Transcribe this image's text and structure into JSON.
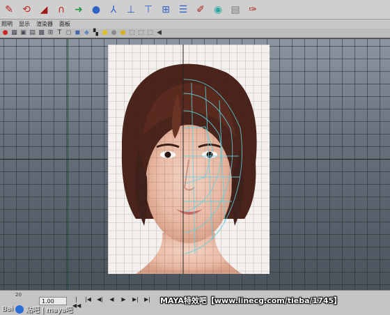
{
  "shelf": {
    "icons": [
      {
        "name": "curve-tool-icon",
        "glyph": "✎",
        "color": "#b8211b"
      },
      {
        "name": "lasso-icon",
        "glyph": "⟲",
        "color": "#c0261d"
      },
      {
        "name": "bevel-icon",
        "glyph": "◢",
        "color": "#9e1a16"
      },
      {
        "name": "magnet-icon",
        "glyph": "∩",
        "color": "#c72420"
      },
      {
        "name": "arrow-right-icon",
        "glyph": "➜",
        "color": "#24983a"
      },
      {
        "name": "sphere-icon",
        "glyph": "●",
        "color": "#2f63c8"
      },
      {
        "name": "joint-icon",
        "glyph": "⅄",
        "color": "#2f63c8"
      },
      {
        "name": "skeleton-icon",
        "glyph": "⊥",
        "color": "#2f63c8"
      },
      {
        "name": "hierarchy-icon",
        "glyph": "⊤",
        "color": "#2f63c8"
      },
      {
        "name": "blend-icon",
        "glyph": "⊞",
        "color": "#2f63c8"
      },
      {
        "name": "list-icon",
        "glyph": "☰",
        "color": "#2f63c8"
      },
      {
        "name": "paint-icon",
        "glyph": "✐",
        "color": "#b0221c"
      },
      {
        "name": "render-icon",
        "glyph": "◉",
        "color": "#2aa7a0"
      },
      {
        "name": "layer-icon",
        "glyph": "▤",
        "color": "#777777"
      },
      {
        "name": "brush-icon",
        "glyph": "✑",
        "color": "#b22b22"
      }
    ]
  },
  "menubar": {
    "items": [
      "照明",
      "显示",
      "渲染器",
      "面板"
    ]
  },
  "viewtools": {
    "icons": [
      {
        "name": "camera-icon",
        "glyph": "●",
        "color": "#c22"
      },
      {
        "name": "wireframe-icon",
        "glyph": "▦",
        "color": "#445"
      },
      {
        "name": "shaded-icon",
        "glyph": "▣",
        "color": "#445"
      },
      {
        "name": "textured-icon",
        "glyph": "▤",
        "color": "#445"
      },
      {
        "name": "lights-icon",
        "glyph": "▩",
        "color": "#445"
      },
      {
        "name": "grid-toggle-icon",
        "glyph": "⊞",
        "color": "#445"
      },
      {
        "name": "text-icon",
        "glyph": "T",
        "color": "#222"
      },
      {
        "name": "cube-wire-icon",
        "glyph": "◻",
        "color": "#555"
      },
      {
        "name": "cube-shaded-icon",
        "glyph": "◼",
        "color": "#4466aa"
      },
      {
        "name": "cube-smooth-icon",
        "glyph": "◆",
        "color": "#6688bb"
      },
      {
        "name": "checker-icon",
        "glyph": "▚",
        "color": "#222"
      },
      {
        "name": "light-icon",
        "glyph": "●",
        "color": "#e0c020"
      },
      {
        "name": "shadow-icon",
        "glyph": "●",
        "color": "#888"
      },
      {
        "name": "ao-icon",
        "glyph": "●",
        "color": "#d8b020"
      },
      {
        "name": "select-icon",
        "glyph": "⬚",
        "color": "#555"
      },
      {
        "name": "isolate-icon",
        "glyph": "⬚",
        "color": "#555"
      },
      {
        "name": "xray-icon",
        "glyph": "⬚",
        "color": "#555"
      },
      {
        "name": "manip-icon",
        "glyph": "◀",
        "color": "#333"
      }
    ]
  },
  "timebar": {
    "frame_number": "20",
    "current_time": "1.00",
    "controls": [
      "|◀◀",
      "|◀",
      "◀|",
      "◀",
      "▶",
      "▶|",
      "▶|"
    ]
  },
  "watermark": {
    "right": "MAYA特效吧【www.linecg.com/tieba/1745】",
    "left_brand": "Bai",
    "left_text": "贴吧 | maya吧"
  }
}
